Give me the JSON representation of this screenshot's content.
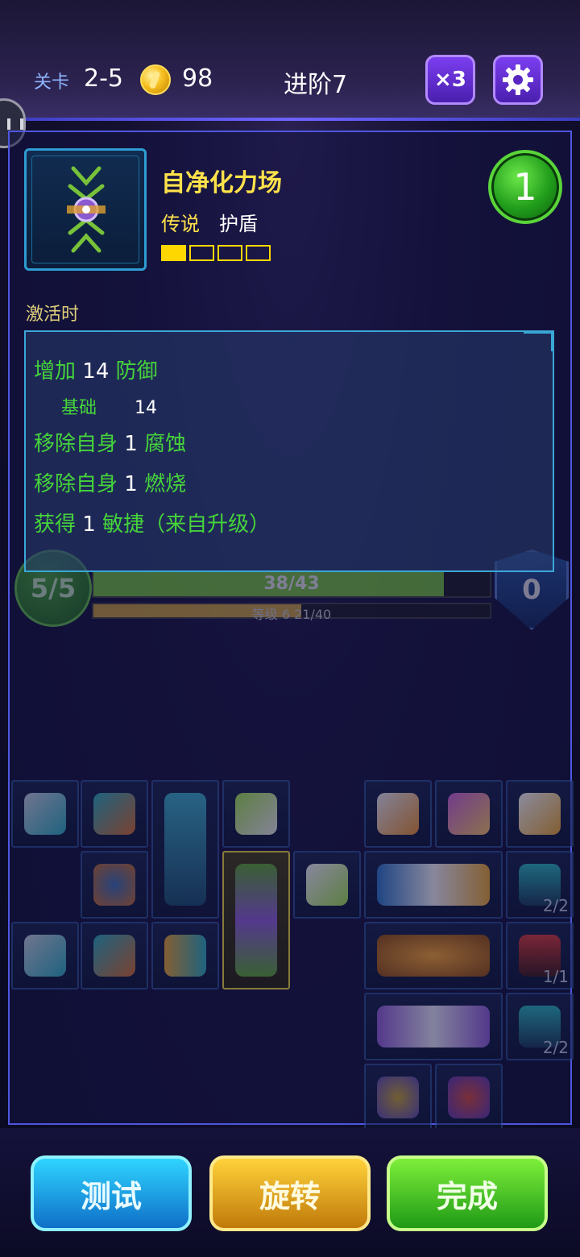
{
  "hud": {
    "level_label": "关卡",
    "level_value": "2-5",
    "coins": "98",
    "tier": "进阶7",
    "speed_label": "×3"
  },
  "item": {
    "name": "自净化力场",
    "rarity": "传说",
    "type": "护盾",
    "upgrade_level": 1,
    "upgrade_max": 4,
    "cost": "1",
    "activate_label": "激活时",
    "effects": [
      {
        "prefix": "增加",
        "value": "14",
        "suffix": "防御"
      },
      {
        "prefix": "基础",
        "value": "14",
        "suffix": ""
      },
      {
        "prefix": "移除自身",
        "value": "1",
        "suffix": "腐蚀"
      },
      {
        "prefix": "移除自身",
        "value": "1",
        "suffix": "燃烧"
      },
      {
        "prefix": "获得",
        "value": "1",
        "suffix": "敏捷（来自升级）"
      }
    ]
  },
  "status": {
    "energy": "5/5",
    "hp_text": "38/43",
    "hp_fraction": 0.884,
    "xp_text": "等级 6  21/40",
    "xp_fraction": 0.525,
    "shield": "0"
  },
  "inventory": {
    "counts": [
      "2/2",
      "1/1",
      "2/2"
    ]
  },
  "buttons": {
    "test": "测试",
    "rotate": "旋转",
    "done": "完成"
  },
  "colors": {
    "rarity_gold": "#ffe24a",
    "effect_green": "#45d43a",
    "panel_border": "#4f56e0"
  }
}
